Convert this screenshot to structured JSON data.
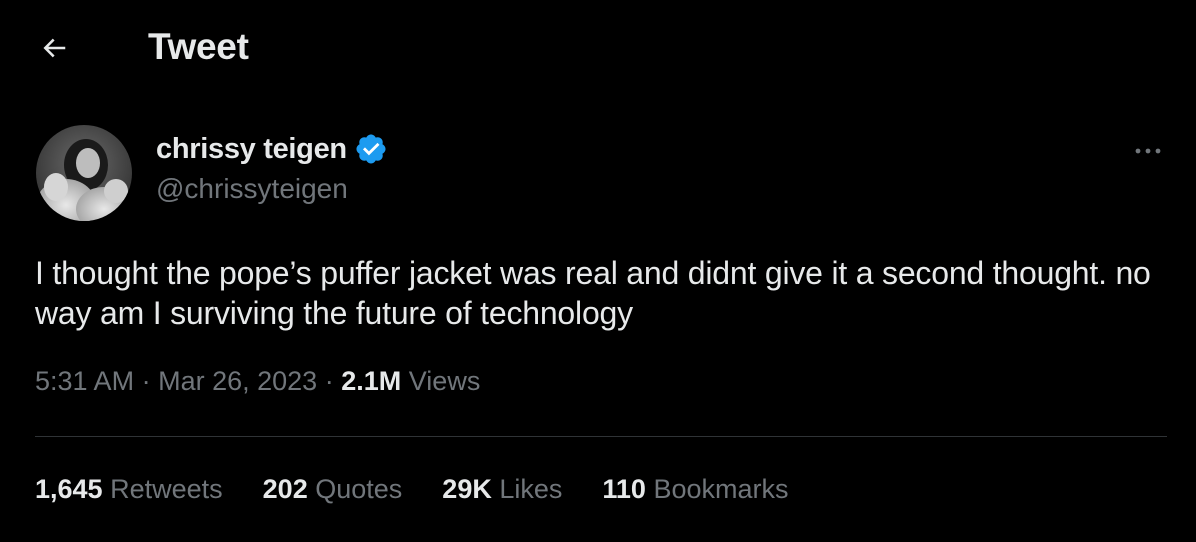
{
  "header": {
    "title": "Tweet",
    "back_icon": "arrow-left-icon"
  },
  "author": {
    "display_name": "chrissy teigen",
    "handle": "@chrissyteigen",
    "verified": true,
    "verified_color": "#1d9bf0"
  },
  "more_icon": "more-horizontal-icon",
  "tweet": {
    "text": "I thought the pope’s puffer jacket was real and didnt give it a second thought. no way am I surviving the future of technology",
    "time": "5:31 AM",
    "date": "Mar 26, 2023",
    "views_count": "2.1M",
    "views_label": "Views",
    "separator": "·"
  },
  "stats": {
    "retweets": {
      "count": "1,645",
      "label": "Retweets"
    },
    "quotes": {
      "count": "202",
      "label": "Quotes"
    },
    "likes": {
      "count": "29K",
      "label": "Likes"
    },
    "bookmarks": {
      "count": "110",
      "label": "Bookmarks"
    }
  },
  "colors": {
    "background": "#000000",
    "primary_text": "#e7e9ea",
    "secondary_text": "#71767b",
    "divider": "#2f3336"
  }
}
